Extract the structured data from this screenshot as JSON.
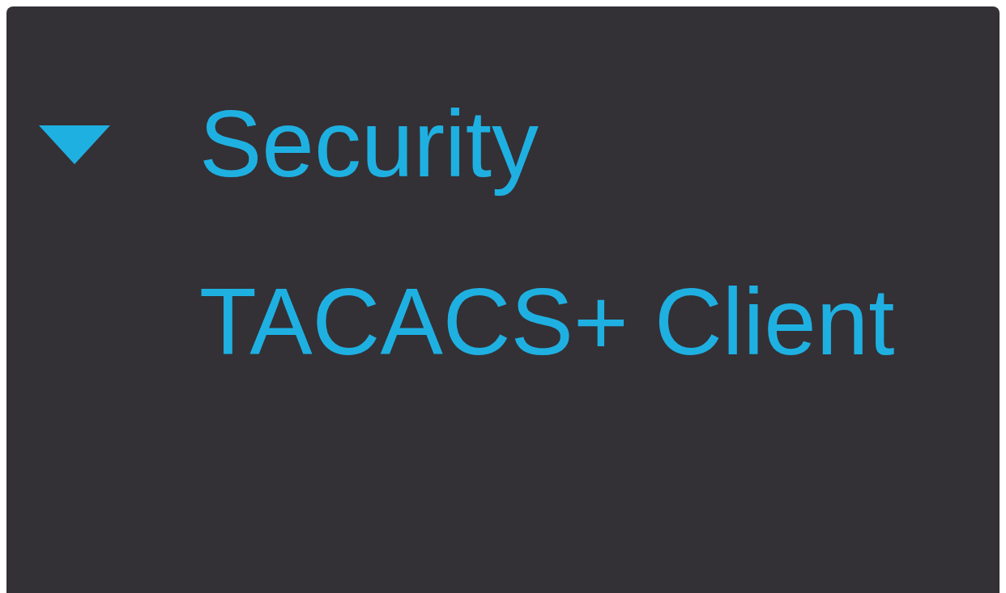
{
  "nav": {
    "items": [
      {
        "label": "Security",
        "expanded": true,
        "children": [
          {
            "label": "TACACS+ Client"
          }
        ]
      }
    ]
  }
}
